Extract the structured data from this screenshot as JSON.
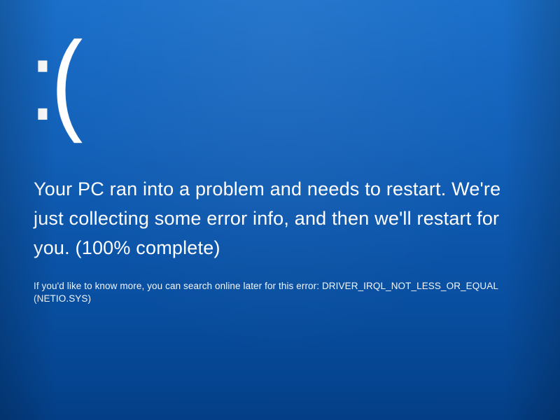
{
  "bsod": {
    "emoticon": ":(",
    "message": "Your PC ran into a problem and needs to restart. We're just collecting some error info, and then we'll restart for you. (100% complete)",
    "detail": "If you'd like to know more, you can search online later for this error: DRIVER_IRQL_NOT_LESS_OR_EQUAL (NETIO.SYS)"
  }
}
